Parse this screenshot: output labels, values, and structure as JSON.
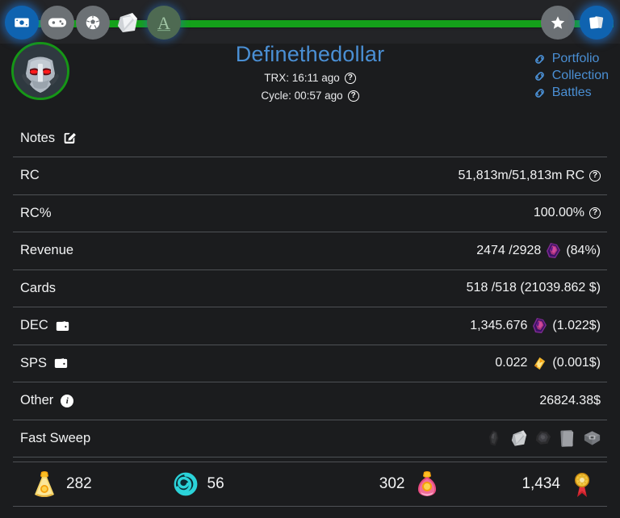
{
  "header": {
    "nav_left": [
      {
        "name": "money-icon",
        "label": "Money"
      },
      {
        "name": "gamepad-icon",
        "label": "Games"
      },
      {
        "name": "soccer-ball-icon",
        "label": "Sports"
      },
      {
        "name": "card-pack-icon",
        "label": "Packs"
      },
      {
        "name": "letter-a-icon",
        "label": "Archmage"
      }
    ],
    "nav_right": [
      {
        "name": "star-icon",
        "label": "Favorites"
      },
      {
        "name": "cards-icon",
        "label": "Cards"
      }
    ],
    "avatar_name": "robot-avatar",
    "title": "Definethedollar",
    "trx_label": "TRX: 16:11 ago",
    "cycle_label": "Cycle: 00:57 ago",
    "help_glyph": "?",
    "links": [
      {
        "label": "Portfolio"
      },
      {
        "label": "Collection"
      },
      {
        "label": "Battles"
      }
    ]
  },
  "rows": [
    {
      "label": "Notes",
      "value": "",
      "icon": "edit-icon"
    },
    {
      "label": "RC",
      "value": "51,813m/51,813m RC",
      "help": "?"
    },
    {
      "label": "RC%",
      "value": "100.00%",
      "help": "?"
    },
    {
      "label": "Revenue",
      "value_pre": "2474 /2928",
      "gem": "dec-gem-icon",
      "value_post": "(84%)"
    },
    {
      "label": "Cards",
      "value": "518 /518 (21039.862 $)"
    },
    {
      "label": "DEC",
      "icon": "wallet-icon",
      "value_pre": "1,345.676",
      "gem": "dec-gem-icon",
      "value_post": "(1.022$)"
    },
    {
      "label": "SPS",
      "icon": "wallet-icon",
      "value_pre": "0.022",
      "gem": "sps-icon",
      "value_post": "(0.001$)"
    },
    {
      "label": "Other",
      "icon": "info-icon",
      "value": "26824.38$"
    },
    {
      "label": "Fast Sweep",
      "sweep_icons": [
        "dark-potion-icon",
        "white-pack-icon",
        "dark-crumple-icon",
        "gray-card-icon",
        "gray-chest-icon"
      ]
    }
  ],
  "bottom_stats": [
    {
      "icon": "gold-potion-icon",
      "value": "282",
      "order": "icon-first"
    },
    {
      "icon": "teal-vortex-icon",
      "value": "56",
      "order": "icon-first"
    },
    {
      "icon": "pink-potion-icon",
      "value": "302",
      "order": "value-first"
    },
    {
      "icon": "gold-medal-icon",
      "value": "1,434",
      "order": "value-first"
    }
  ],
  "colors": {
    "accent_blue": "#4a8fd4",
    "progress_green": "#14a01a",
    "background": "#1b1c1e",
    "divider": "#4e5155"
  }
}
